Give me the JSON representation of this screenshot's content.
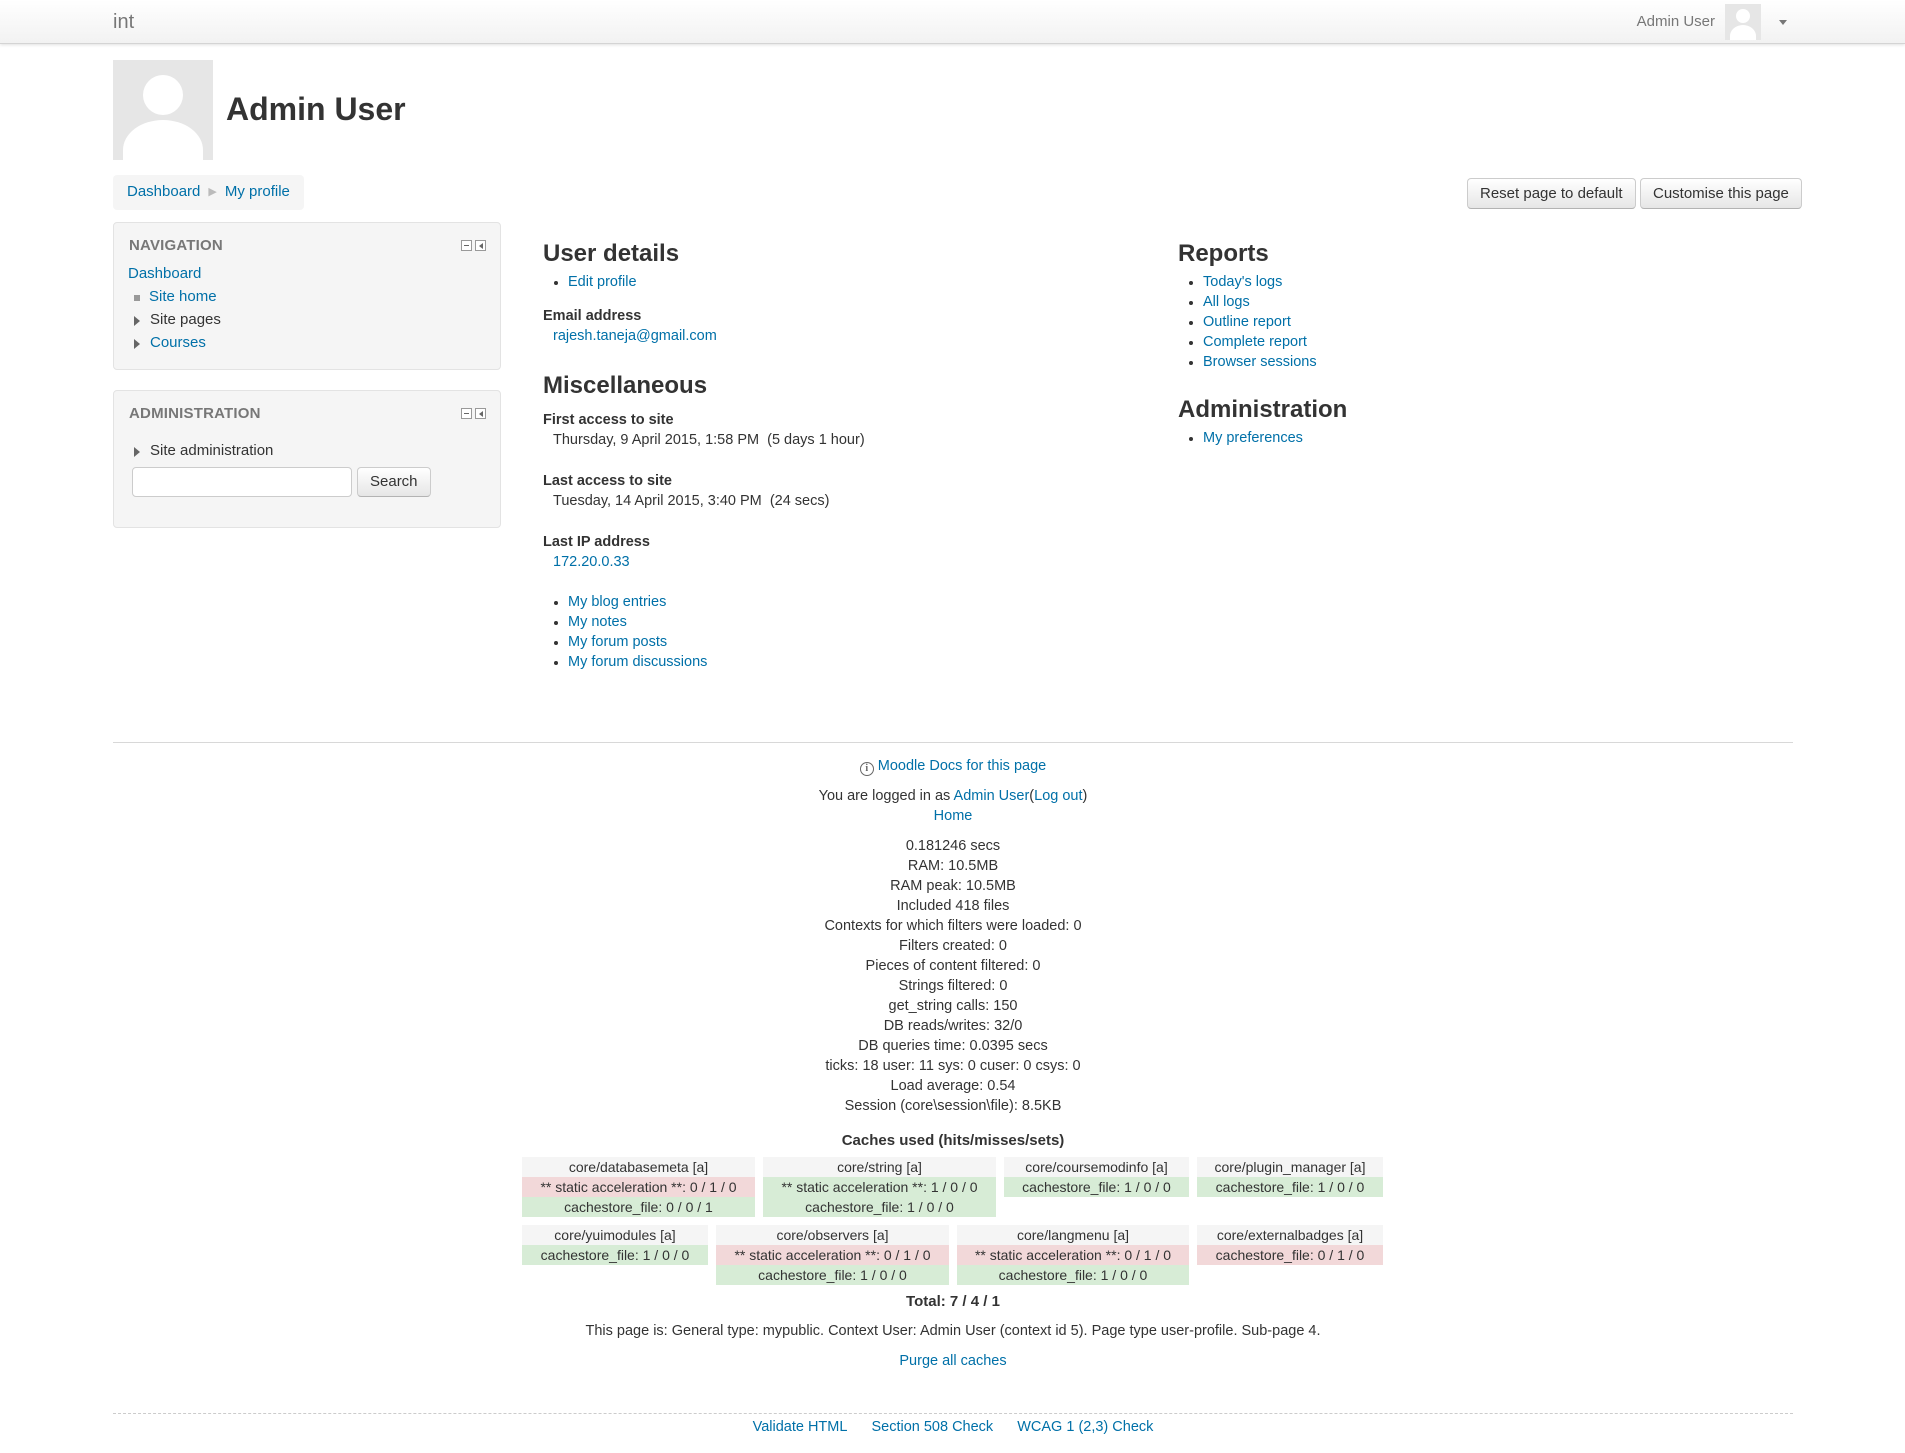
{
  "navbar": {
    "brand": "int",
    "user_name": "Admin User",
    "avatar_icon": "user-avatar-icon",
    "menu_icon": "caret-down-icon"
  },
  "header": {
    "title": "Admin User",
    "breadcrumb": [
      "Dashboard",
      "My profile"
    ],
    "reset_button": "Reset page to default",
    "customise_button": "Customise this page"
  },
  "navigation_block": {
    "title": "NAVIGATION",
    "root": "Dashboard",
    "items": [
      {
        "label": "Site home",
        "icon": "bullet-square-icon"
      },
      {
        "label": "Site pages",
        "icon": "expand-triangle-icon"
      },
      {
        "label": "Courses",
        "icon": "expand-triangle-icon"
      }
    ]
  },
  "administration_block": {
    "title": "ADMINISTRATION",
    "items": [
      {
        "label": "Site administration",
        "icon": "expand-triangle-icon"
      }
    ],
    "search_value": "",
    "search_button": "Search"
  },
  "user_details": {
    "heading": "User details",
    "edit_profile": "Edit profile",
    "email_label": "Email address",
    "email_value": "rajesh.taneja@gmail.com"
  },
  "miscellaneous": {
    "heading": "Miscellaneous",
    "first_access_label": "First access to site",
    "first_access_value": "Thursday, 9 April 2015, 1:58 PM  (5 days 1 hour)",
    "last_access_label": "Last access to site",
    "last_access_value": "Tuesday, 14 April 2015, 3:40 PM  (24 secs)",
    "last_ip_label": "Last IP address",
    "last_ip_value": "172.20.0.33",
    "links": [
      "My blog entries",
      "My notes",
      "My forum posts",
      "My forum discussions"
    ]
  },
  "reports": {
    "heading": "Reports",
    "links": [
      "Today's logs",
      "All logs",
      "Outline report",
      "Complete report",
      "Browser sessions"
    ]
  },
  "administration": {
    "heading": "Administration",
    "links": [
      "My preferences"
    ]
  },
  "footer": {
    "docs_link": "Moodle Docs for this page",
    "logged_in_prefix": "You are logged in as",
    "logged_in_user": "Admin User",
    "logout": "Log out",
    "home": "Home",
    "perf": [
      "0.181246 secs",
      "RAM: 10.5MB",
      "RAM peak: 10.5MB",
      "Included 418 files",
      "Contexts for which filters were loaded: 0",
      "Filters created: 0",
      "Pieces of content filtered: 0",
      "Strings filtered: 0",
      "get_string calls: 150",
      "DB reads/writes: 32/0",
      "DB queries time: 0.0395 secs",
      "ticks: 18 user: 11 sys: 0 cuser: 0 csys: 0",
      "Load average: 0.54",
      "Session (core\\session\\file): 8.5KB"
    ],
    "caches_title": "Caches used (hits/misses/sets)",
    "caches": [
      {
        "name": "core/databasemeta [a]",
        "rows": [
          {
            "text": "** static acceleration **: 0 / 1 / 0",
            "status": "miss"
          },
          {
            "text": "cachestore_file: 0 / 0 / 1",
            "status": "hit"
          }
        ]
      },
      {
        "name": "core/string [a]",
        "rows": [
          {
            "text": "** static acceleration **: 1 / 0 / 0",
            "status": "hit"
          },
          {
            "text": "cachestore_file: 1 / 0 / 0",
            "status": "hit"
          }
        ]
      },
      {
        "name": "core/coursemodinfo [a]",
        "rows": [
          {
            "text": "cachestore_file: 1 / 0 / 0",
            "status": "hit"
          }
        ]
      },
      {
        "name": "core/plugin_manager [a]",
        "rows": [
          {
            "text": "cachestore_file: 1 / 0 / 0",
            "status": "hit"
          }
        ]
      },
      {
        "name": "core/yuimodules [a]",
        "rows": [
          {
            "text": "cachestore_file: 1 / 0 / 0",
            "status": "hit"
          }
        ]
      },
      {
        "name": "core/observers [a]",
        "rows": [
          {
            "text": "** static acceleration **: 0 / 1 / 0",
            "status": "miss"
          },
          {
            "text": "cachestore_file: 1 / 0 / 0",
            "status": "hit"
          }
        ]
      },
      {
        "name": "core/langmenu [a]",
        "rows": [
          {
            "text": "** static acceleration **: 0 / 1 / 0",
            "status": "miss"
          },
          {
            "text": "cachestore_file: 1 / 0 / 0",
            "status": "hit"
          }
        ]
      },
      {
        "name": "core/externalbadges [a]",
        "rows": [
          {
            "text": "cachestore_file: 0 / 1 / 0",
            "status": "miss"
          }
        ]
      }
    ],
    "total": "Total: 7 / 4 / 1",
    "page_info": "This page is: General type: mypublic. Context User: Admin User (context id 5). Page type user-profile. Sub-page 4.",
    "purge": "Purge all caches",
    "validators": [
      "Validate HTML",
      "Section 508 Check",
      "WCAG 1 (2,3) Check"
    ]
  },
  "colors": {
    "link": "#0070a8",
    "cache_hit": "#d7ecd6",
    "cache_miss": "#f2d8d9"
  }
}
